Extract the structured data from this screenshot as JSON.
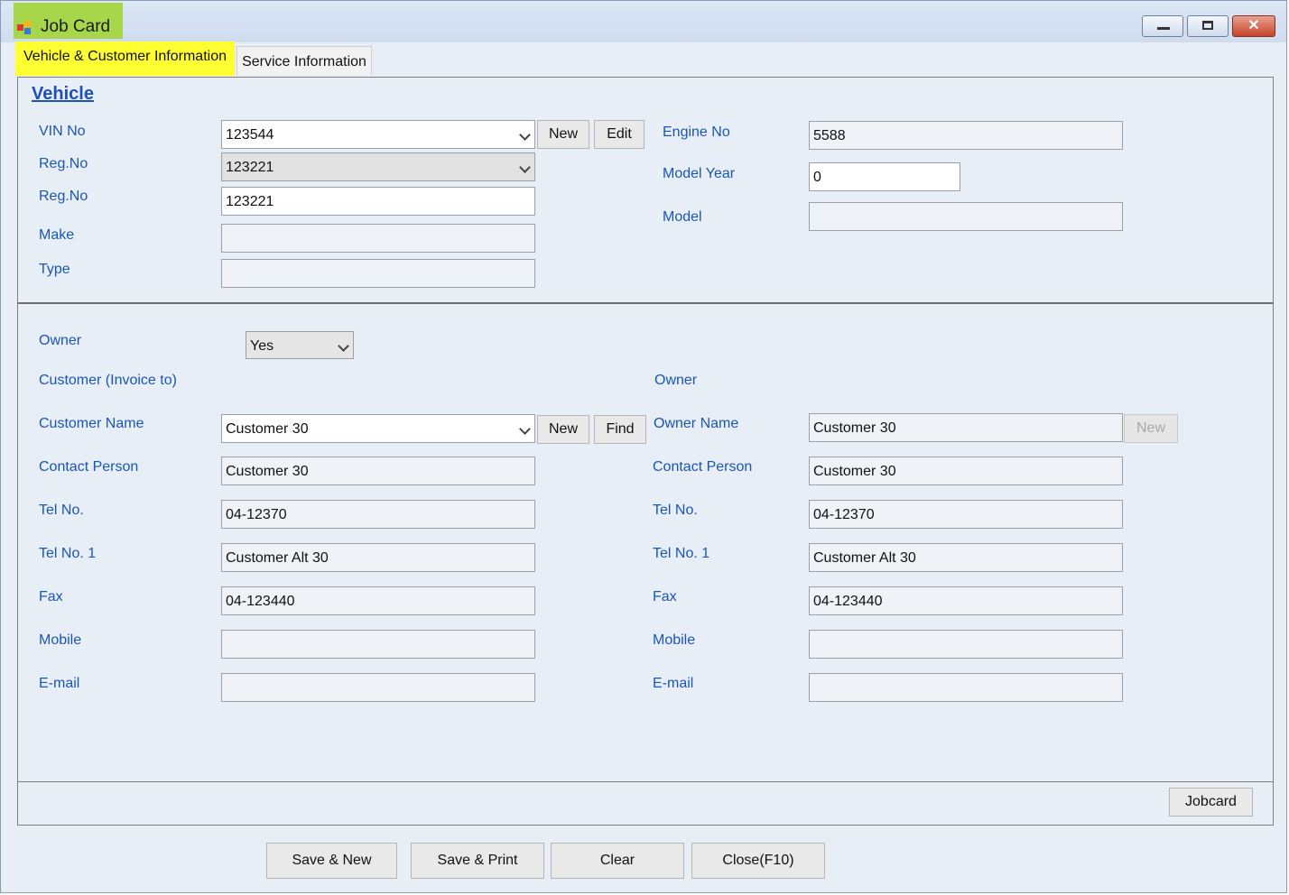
{
  "window": {
    "title": "Job Card"
  },
  "tabs": [
    {
      "label": "Vehicle & Customer Information",
      "active": true
    },
    {
      "label": "Service Information",
      "active": false
    }
  ],
  "vehicle": {
    "section_title": "Vehicle",
    "vin_no": {
      "label": "VIN No",
      "value": "123544"
    },
    "reg_no_combo": {
      "label": "Reg.No",
      "value": "123221"
    },
    "reg_no_text": {
      "label": "Reg.No",
      "value": "123221"
    },
    "make": {
      "label": "Make",
      "value": ""
    },
    "type": {
      "label": "Type",
      "value": ""
    },
    "engine_no": {
      "label": "Engine No",
      "value": "5588"
    },
    "model_year": {
      "label": "Model Year",
      "value": "0"
    },
    "model": {
      "label": "Model",
      "value": ""
    },
    "new_label": "New",
    "edit_label": "Edit"
  },
  "customer": {
    "owner_label": "Owner",
    "owner_value": "Yes",
    "invoice_to_label": "Customer (Invoice to)",
    "name": {
      "label": "Customer Name",
      "value": "Customer 30"
    },
    "contact_person": {
      "label": "Contact Person",
      "value": "Customer 30"
    },
    "tel": {
      "label": "Tel No.",
      "value": "04-12370"
    },
    "tel1": {
      "label": "Tel No. 1",
      "value": "Customer Alt 30"
    },
    "fax": {
      "label": "Fax",
      "value": "04-123440"
    },
    "mobile": {
      "label": "Mobile",
      "value": ""
    },
    "email": {
      "label": "E-mail",
      "value": ""
    },
    "new_label": "New",
    "find_label": "Find"
  },
  "owner": {
    "section_label": "Owner",
    "name": {
      "label": "Owner Name",
      "value": "Customer 30"
    },
    "contact_person": {
      "label": "Contact Person",
      "value": "Customer 30"
    },
    "tel": {
      "label": "Tel No.",
      "value": "04-12370"
    },
    "tel1": {
      "label": "Tel No. 1",
      "value": "Customer Alt 30"
    },
    "fax": {
      "label": "Fax",
      "value": "04-123440"
    },
    "mobile": {
      "label": "Mobile",
      "value": ""
    },
    "email": {
      "label": "E-mail",
      "value": ""
    },
    "new_label": "New"
  },
  "jobcard_button": "Jobcard",
  "footer": {
    "save_new": "Save & New",
    "save_print": "Save & Print",
    "clear": "Clear",
    "close": "Close(F10)"
  }
}
